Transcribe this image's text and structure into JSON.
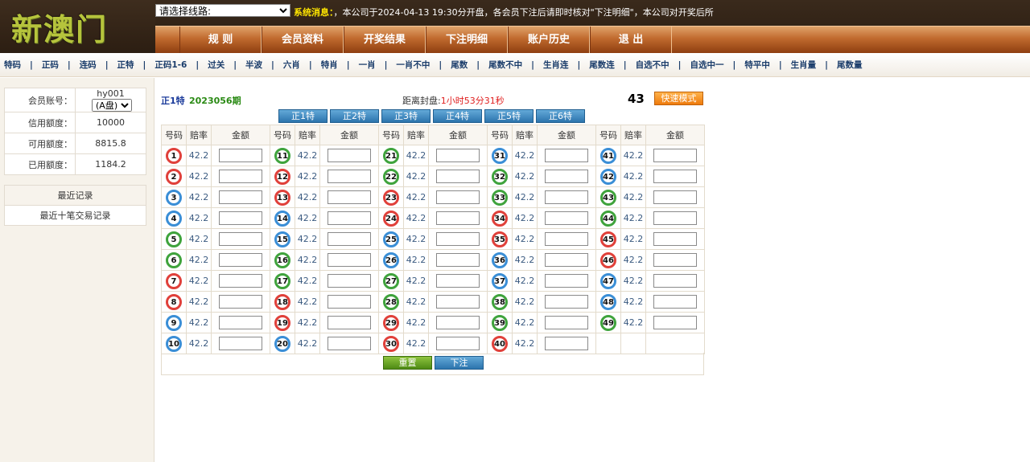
{
  "header": {
    "logo": "新澳门",
    "line_select": "请选择线路:",
    "notice_label": "系统消息：",
    "notice_text": "，本公司于2024-04-13 19:30分开盘，各会员下注后请即时核对\"下注明细\"，本公司对开奖后所"
  },
  "nav": {
    "items": [
      "规 则",
      "会员资料",
      "开奖结果",
      "下注明细",
      "账户历史",
      "退 出"
    ]
  },
  "subnav": {
    "items": [
      "特码",
      "正码",
      "连码",
      "正特",
      "正码1-6",
      "过关",
      "半波",
      "六肖",
      "特肖",
      "一肖",
      "一肖不中",
      "尾数",
      "尾数不中",
      "生肖连",
      "尾数连",
      "自选不中",
      "自选中一",
      "特平中",
      "生肖量",
      "尾数量"
    ]
  },
  "sidebar": {
    "account_label": "会员账号：",
    "account_value": "hy001",
    "plate_option": "(A盘)",
    "credit_label": "信用额度：",
    "credit_value": "10000",
    "available_label": "可用额度：",
    "available_value": "8815.8",
    "used_label": "已用额度：",
    "used_value": "1184.2",
    "recent_title": "最近记录",
    "recent_link": "最近十笔交易记录"
  },
  "main": {
    "draw_label": "正1特",
    "draw_no": "2023056期",
    "countdown_label": "距离封盘:",
    "countdown": "1小时53分31秒",
    "big_number": "43",
    "fast_mode": "快速模式",
    "tabs": [
      "正1特",
      "正2特",
      "正3特",
      "正4特",
      "正5特",
      "正6特"
    ],
    "col_headers": {
      "number": "号码",
      "odds": "赔率",
      "amount": "金额"
    },
    "odds": "42.2",
    "reset": "重置",
    "submit": "下注"
  },
  "balls": [
    {
      "n": "1",
      "c": "red"
    },
    {
      "n": "2",
      "c": "red"
    },
    {
      "n": "3",
      "c": "blue"
    },
    {
      "n": "4",
      "c": "blue"
    },
    {
      "n": "5",
      "c": "green"
    },
    {
      "n": "6",
      "c": "green"
    },
    {
      "n": "7",
      "c": "red"
    },
    {
      "n": "8",
      "c": "red"
    },
    {
      "n": "9",
      "c": "blue"
    },
    {
      "n": "10",
      "c": "blue"
    },
    {
      "n": "11",
      "c": "green"
    },
    {
      "n": "12",
      "c": "red"
    },
    {
      "n": "13",
      "c": "red"
    },
    {
      "n": "14",
      "c": "blue"
    },
    {
      "n": "15",
      "c": "blue"
    },
    {
      "n": "16",
      "c": "green"
    },
    {
      "n": "17",
      "c": "green"
    },
    {
      "n": "18",
      "c": "red"
    },
    {
      "n": "19",
      "c": "red"
    },
    {
      "n": "20",
      "c": "blue"
    },
    {
      "n": "21",
      "c": "green"
    },
    {
      "n": "22",
      "c": "green"
    },
    {
      "n": "23",
      "c": "red"
    },
    {
      "n": "24",
      "c": "red"
    },
    {
      "n": "25",
      "c": "blue"
    },
    {
      "n": "26",
      "c": "blue"
    },
    {
      "n": "27",
      "c": "green"
    },
    {
      "n": "28",
      "c": "green"
    },
    {
      "n": "29",
      "c": "red"
    },
    {
      "n": "30",
      "c": "red"
    },
    {
      "n": "31",
      "c": "blue"
    },
    {
      "n": "32",
      "c": "green"
    },
    {
      "n": "33",
      "c": "green"
    },
    {
      "n": "34",
      "c": "red"
    },
    {
      "n": "35",
      "c": "red"
    },
    {
      "n": "36",
      "c": "blue"
    },
    {
      "n": "37",
      "c": "blue"
    },
    {
      "n": "38",
      "c": "green"
    },
    {
      "n": "39",
      "c": "green"
    },
    {
      "n": "40",
      "c": "red"
    },
    {
      "n": "41",
      "c": "blue"
    },
    {
      "n": "42",
      "c": "blue"
    },
    {
      "n": "43",
      "c": "green"
    },
    {
      "n": "44",
      "c": "green"
    },
    {
      "n": "45",
      "c": "red"
    },
    {
      "n": "46",
      "c": "red"
    },
    {
      "n": "47",
      "c": "blue"
    },
    {
      "n": "48",
      "c": "blue"
    },
    {
      "n": "49",
      "c": "green"
    }
  ]
}
